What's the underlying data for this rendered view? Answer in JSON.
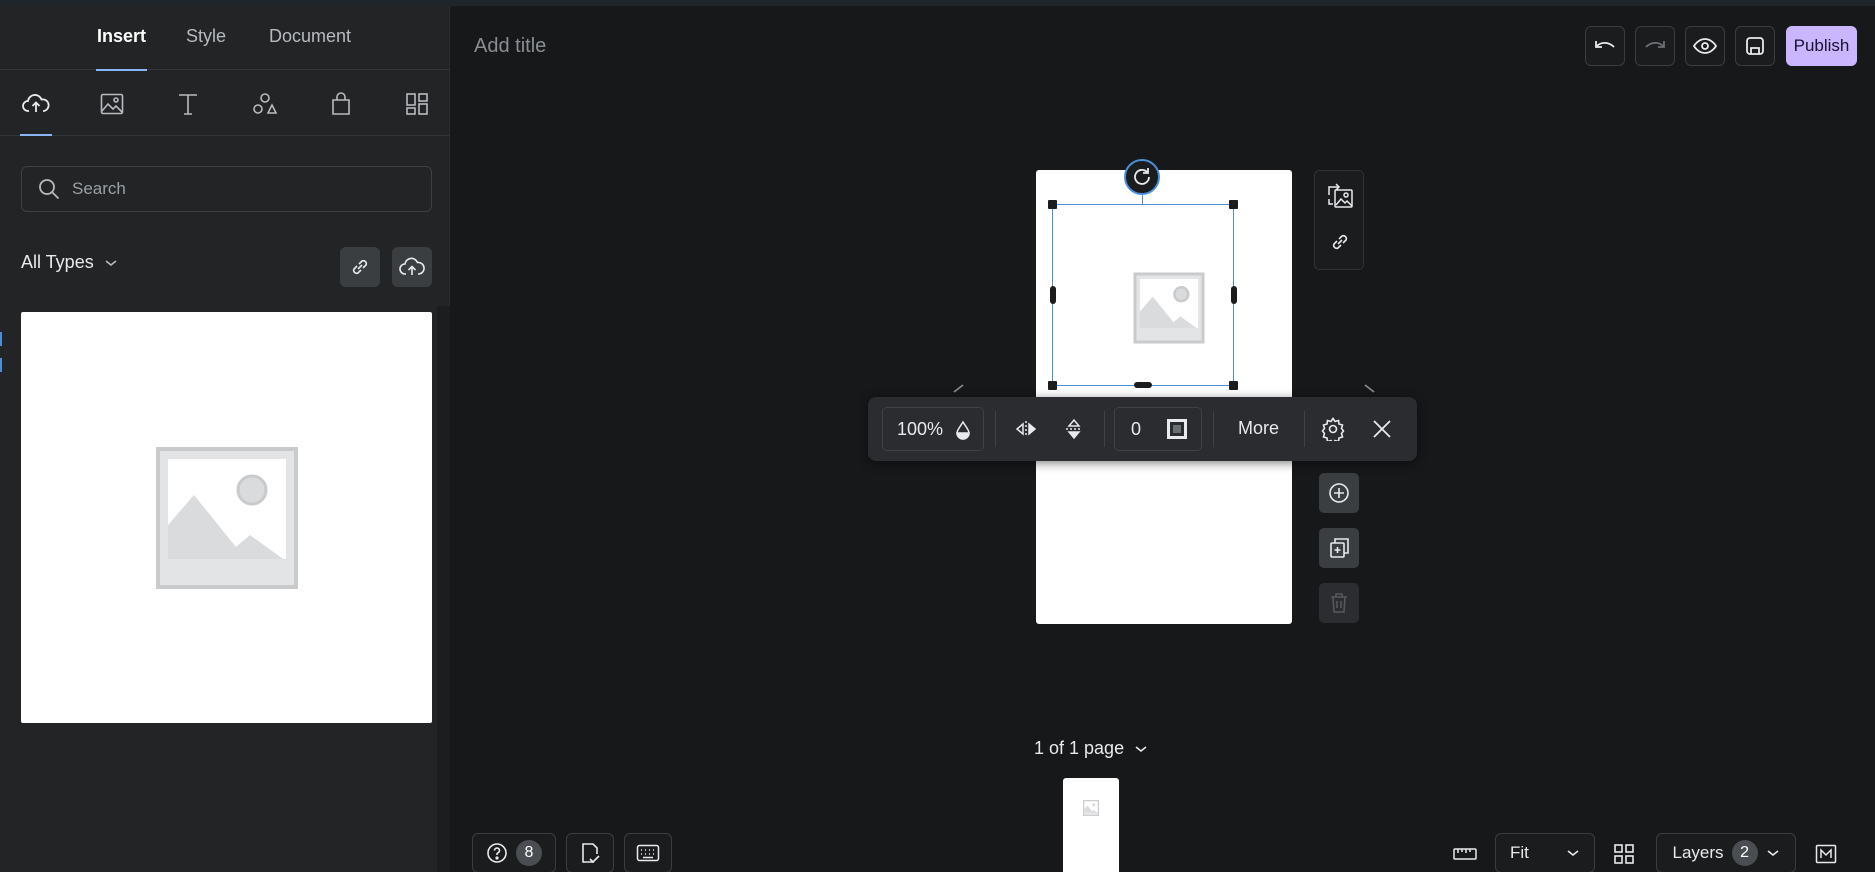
{
  "sidebar": {
    "tabs": [
      "Insert",
      "Style",
      "Document"
    ],
    "active_tab": "Insert",
    "icon_tabs": [
      "upload-cloud-icon",
      "image-icon",
      "text-icon",
      "shapes-icon",
      "shopping-bag-icon",
      "blocks-grid-icon"
    ],
    "search_placeholder": "Search",
    "filter_label": "All Types"
  },
  "editor": {
    "title_placeholder": "Add title",
    "publish_label": "Publish"
  },
  "floating_toolbar": {
    "opacity": "100%",
    "border_width": "0",
    "more_label": "More"
  },
  "pagination": {
    "indicator": "1 of 1 page"
  },
  "footer": {
    "help_count": "8",
    "zoom_value": "Fit",
    "layers_label": "Layers",
    "layers_count": "2"
  },
  "colors": {
    "accent": "#c9b6ff",
    "selection": "#4a90d9",
    "background": "#17181a",
    "panel": "#222426"
  }
}
